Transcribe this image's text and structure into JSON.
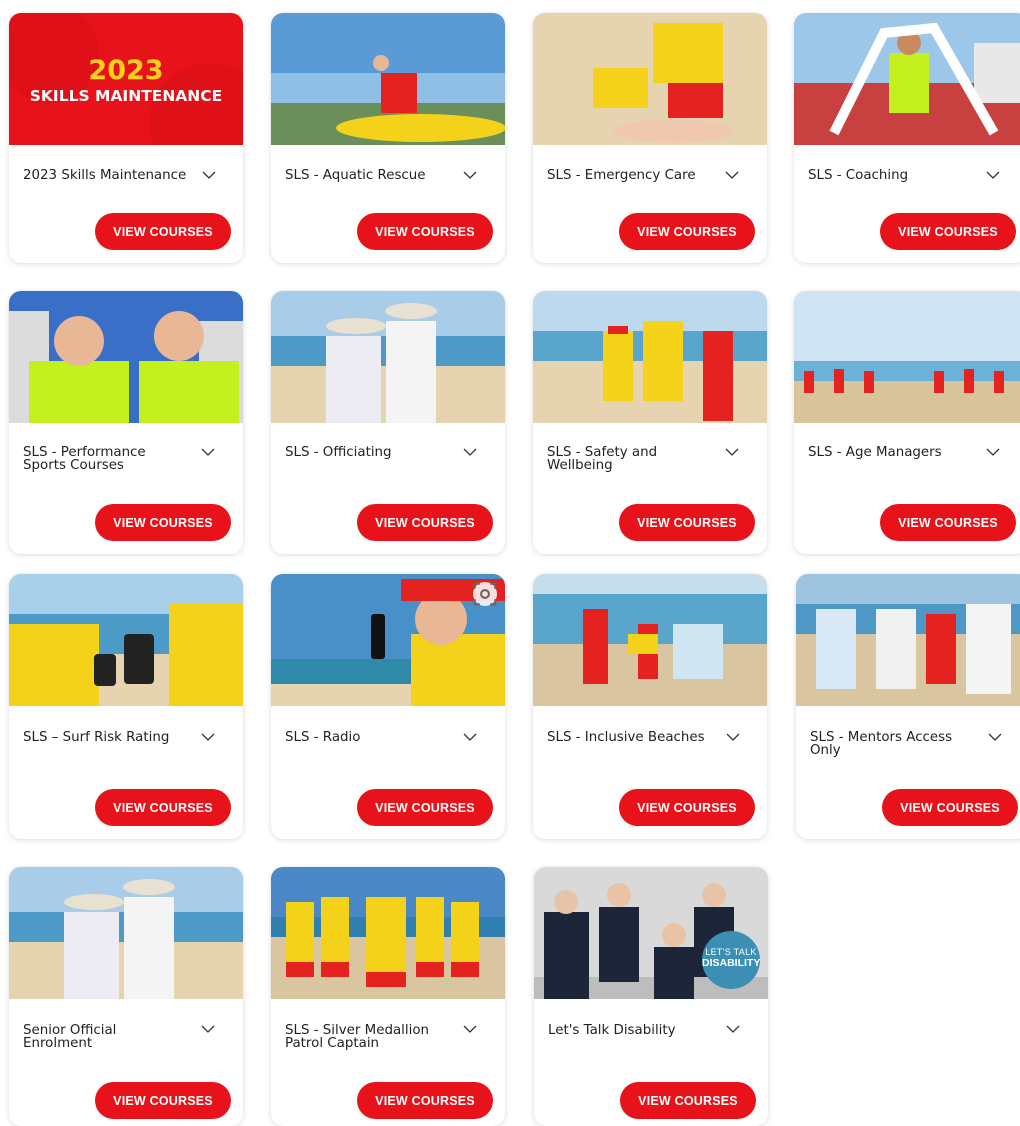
{
  "banner": {
    "year": "2023",
    "subtitle": "SKILLS MAINTENANCE"
  },
  "badge": {
    "line1": "LET'S TALK",
    "line2": "DISABILITY"
  },
  "button_label": "VIEW COURSES",
  "cards": [
    {
      "title": "2023 Skills Maintenance",
      "button": "VIEW COURSES"
    },
    {
      "title": "SLS - Aquatic Rescue",
      "button": "VIEW COURSES"
    },
    {
      "title": "SLS - Emergency Care",
      "button": "VIEW COURSES"
    },
    {
      "title": "SLS - Coaching",
      "button": "VIEW COURSES"
    },
    {
      "title": "SLS - Performance Sports Courses",
      "button": "VIEW COURSES"
    },
    {
      "title": "SLS - Officiating",
      "button": "VIEW COURSES"
    },
    {
      "title": "SLS - Safety and Wellbeing",
      "button": "VIEW COURSES"
    },
    {
      "title": "SLS - Age Managers",
      "button": "VIEW COURSES"
    },
    {
      "title": "SLS – Surf Risk Rating",
      "button": "VIEW COURSES"
    },
    {
      "title": "SLS - Radio",
      "button": "VIEW COURSES"
    },
    {
      "title": "SLS - Inclusive Beaches",
      "button": "VIEW COURSES"
    },
    {
      "title": "SLS - Mentors Access Only",
      "button": "VIEW COURSES"
    },
    {
      "title": "Senior Official Enrolment",
      "button": "VIEW COURSES"
    },
    {
      "title": "SLS - Silver Medallion Patrol Captain",
      "button": "VIEW COURSES"
    },
    {
      "title": "Let's Talk Disability",
      "button": "VIEW COURSES"
    }
  ],
  "colors": {
    "accent": "#e8131a",
    "patrol_yellow": "#f5d21a",
    "patrol_red": "#e42320",
    "sky": "#6fa8dc",
    "sand": "#e6d3b0"
  },
  "icons": [
    "chevron-down-icon",
    "visual-search-icon"
  ]
}
